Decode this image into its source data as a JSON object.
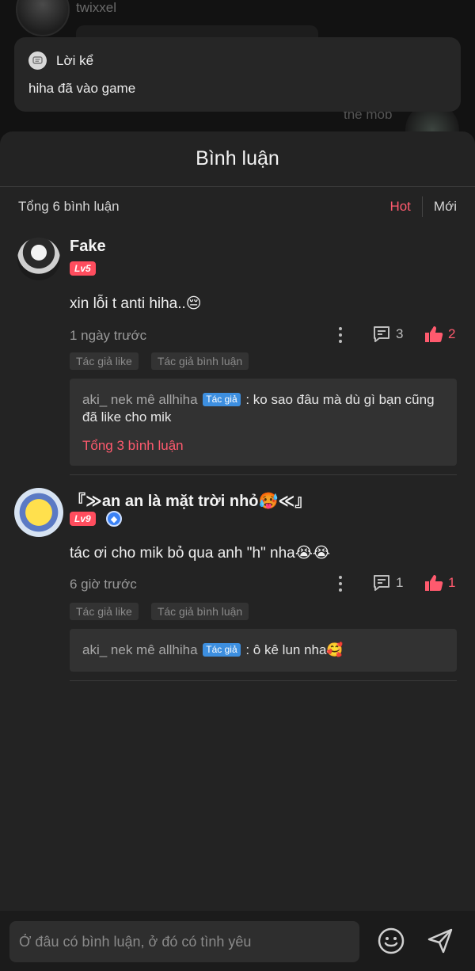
{
  "background_chat": {
    "username_top": "twixxel",
    "username_right": "the mob"
  },
  "narrator": {
    "title": "Lời kể",
    "text": "hiha đã vào game",
    "icon": "chat-bubble-icon"
  },
  "sheet": {
    "title": "Bình luận",
    "total": "Tổng 6 bình luận",
    "sort_hot": "Hot",
    "sort_new": "Mới"
  },
  "comments": [
    {
      "name": "Fake",
      "level": "Lv5",
      "text": "xin lỗi t anti hiha..😔",
      "time": "1 ngày trước",
      "reply_count": "3",
      "like_count": "2",
      "tags": [
        "Tác giả like",
        "Tác giả bình luận"
      ],
      "reply": {
        "author": "aki_ nek mê allhiha",
        "badge": "Tác giả",
        "text": ": ko sao đâu mà dù gì bạn cũng đã like cho mik",
        "total": "Tổng 3 bình luận"
      }
    },
    {
      "name": "『≫an an là mặt trời nhỏ🥵≪』",
      "level": "Lv9",
      "text": "tác ơi cho mik bỏ qua anh \"h\" nha😭😭",
      "time": "6 giờ trước",
      "reply_count": "1",
      "like_count": "1",
      "tags": [
        "Tác giả like",
        "Tác giả bình luận"
      ],
      "reply": {
        "author": "aki_ nek mê allhiha",
        "badge": "Tác giả",
        "text": ": ô kê lun nha🥰"
      }
    }
  ],
  "input": {
    "placeholder": "Ở đâu có bình luận, ở đó có tình yêu"
  },
  "colors": {
    "accent": "#ff5a6e",
    "author_badge": "#3d8fe0",
    "sheet_bg": "#232323"
  }
}
